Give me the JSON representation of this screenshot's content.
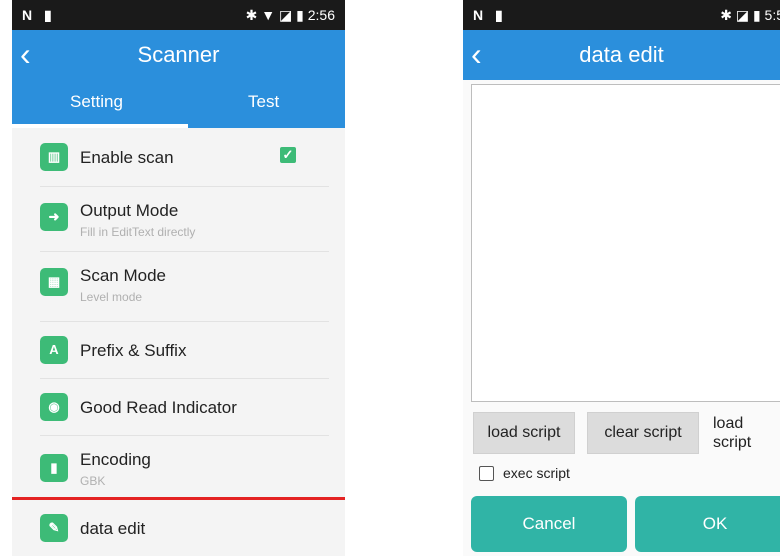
{
  "left_screen": {
    "status_bar": {
      "left_icons": "N ▮",
      "right_text": "✱ ▼ ◪ ▮ 2:56"
    },
    "header": {
      "title": "Scanner"
    },
    "tabs": [
      {
        "label": "Setting"
      },
      {
        "label": "Test"
      }
    ],
    "settings_items": [
      {
        "label": "Enable scan",
        "icon": "barcode-check-icon",
        "icon_glyph": "▥",
        "checked": true
      },
      {
        "label": "Output Mode",
        "sub": "Fill in EditText directly",
        "icon": "output-icon",
        "icon_glyph": "➜"
      },
      {
        "label": "Scan Mode",
        "sub": "Level mode",
        "icon": "scan-mode-icon",
        "icon_glyph": "▦"
      },
      {
        "label": "Prefix & Suffix",
        "icon": "prefix-suffix-icon",
        "icon_glyph": "A"
      },
      {
        "label": "Good Read Indicator",
        "icon": "good-read-icon",
        "icon_glyph": "◉"
      },
      {
        "label": "Encoding",
        "sub": "GBK",
        "icon": "encoding-icon",
        "icon_glyph": "▮"
      },
      {
        "label": "data edit",
        "icon": "data-edit-icon",
        "icon_glyph": "✎"
      }
    ],
    "highlight_color": "#e42323"
  },
  "right_screen": {
    "status_bar": {
      "left_icons": "N ▮",
      "right_text": "✱ ◪ ▮ 5:5"
    },
    "header": {
      "title": "data edit"
    },
    "buttons": {
      "load_script": "load script",
      "clear_script": "clear script"
    },
    "load_label_line1": "load",
    "load_label_line2": "script",
    "exec_script_label": "exec script",
    "cancel_label": "Cancel",
    "ok_label": "OK"
  },
  "colors": {
    "app_bar": "#2b8fdc",
    "icon_green": "#3dbb77",
    "teal_button": "#30b4a6"
  }
}
